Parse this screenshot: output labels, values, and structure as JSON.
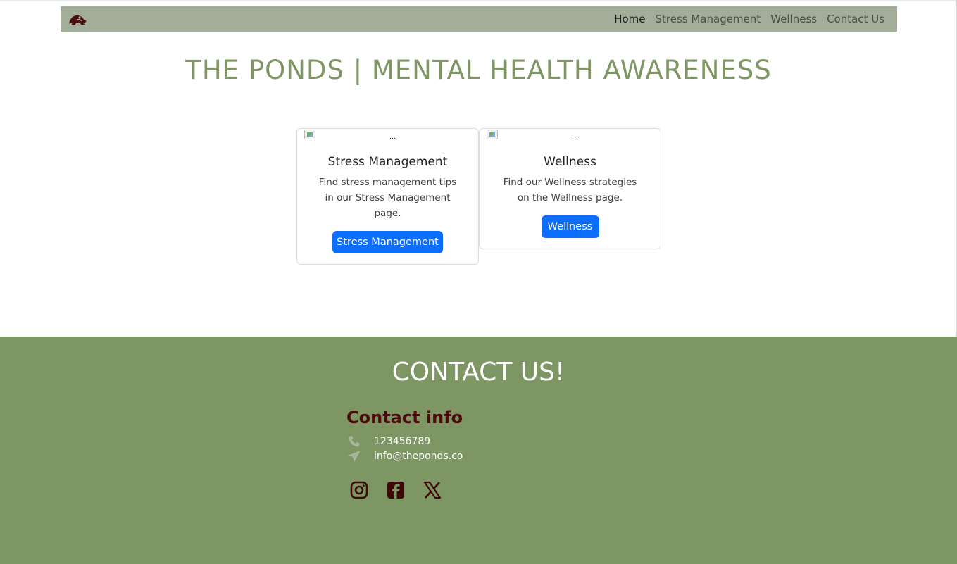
{
  "nav": {
    "brand_icon": "frog-logo-icon",
    "links": [
      {
        "label": "Home",
        "active": true
      },
      {
        "label": "Stress Management",
        "active": false
      },
      {
        "label": "Wellness",
        "active": false
      },
      {
        "label": "Contact Us",
        "active": false
      }
    ]
  },
  "page_title": "THE PONDS | MENTAL HEALTH AWARENESS",
  "cards": [
    {
      "image_alt": "...",
      "title": "Stress Management",
      "text": "Find stress management tips in our Stress Management page.",
      "button": "Stress Management"
    },
    {
      "image_alt": "...",
      "title": "Wellness",
      "text": "Find our Wellness strategies on the Wellness page.",
      "button": "Wellness"
    }
  ],
  "footer": {
    "title": "CONTACT US!",
    "contact_heading": "Contact info",
    "phone": "123456789",
    "email": "info@theponds.co",
    "phone_icon": "phone-icon",
    "email_icon": "paper-plane-icon",
    "socials": [
      "instagram-icon",
      "facebook-icon",
      "x-icon"
    ]
  },
  "colors": {
    "nav_bg": "#a3ae9a",
    "title_green": "#7f9664",
    "footer_bg": "#7e9663",
    "accent_dark_red": "#4a0c0c",
    "button_blue": "#0d6efd"
  }
}
